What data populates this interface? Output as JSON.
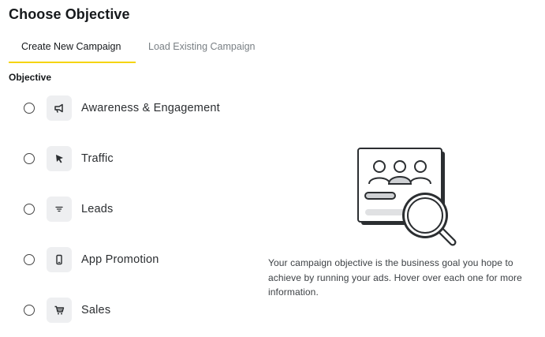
{
  "title": "Choose Objective",
  "tabs": [
    {
      "label": "Create New Campaign",
      "active": true
    },
    {
      "label": "Load Existing Campaign",
      "active": false
    }
  ],
  "accent_color": "#f5d40f",
  "section_label": "Objective",
  "options": [
    {
      "label": "Awareness & Engagement",
      "icon": "megaphone-icon",
      "selected": false
    },
    {
      "label": "Traffic",
      "icon": "cursor-icon",
      "selected": false
    },
    {
      "label": "Leads",
      "icon": "filter-icon",
      "selected": false
    },
    {
      "label": "App Promotion",
      "icon": "phone-icon",
      "selected": false
    },
    {
      "label": "Sales",
      "icon": "cart-icon",
      "selected": false
    }
  ],
  "description": "Your campaign objective is the business goal you hope to achieve by running your ads. Hover over each one for more information."
}
